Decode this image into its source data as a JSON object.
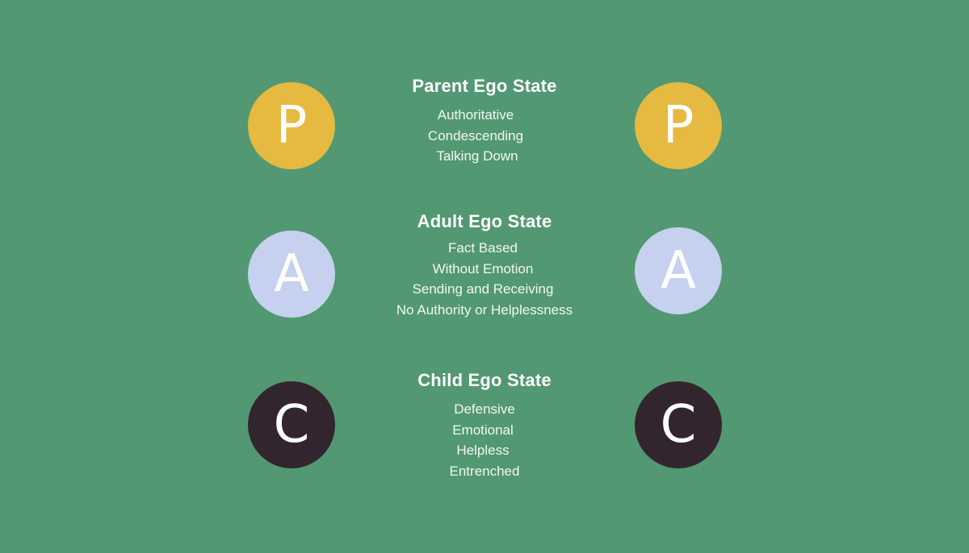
{
  "states": [
    {
      "letter": "P",
      "title": "Parent Ego State",
      "color": "#e6b940",
      "items": [
        "Authoritative",
        "Condescending",
        "Talking Down"
      ]
    },
    {
      "letter": "A",
      "title": "Adult Ego State",
      "color": "#c5d1ee",
      "items": [
        "Fact Based",
        "Without Emotion",
        "Sending and Receiving",
        "No Authority or Helplessness"
      ]
    },
    {
      "letter": "C",
      "title": "Child Ego State",
      "color": "#33252e",
      "items": [
        "Defensive",
        "Emotional",
        "Helpless",
        "Entrenched"
      ]
    }
  ],
  "background_color": "#529872"
}
